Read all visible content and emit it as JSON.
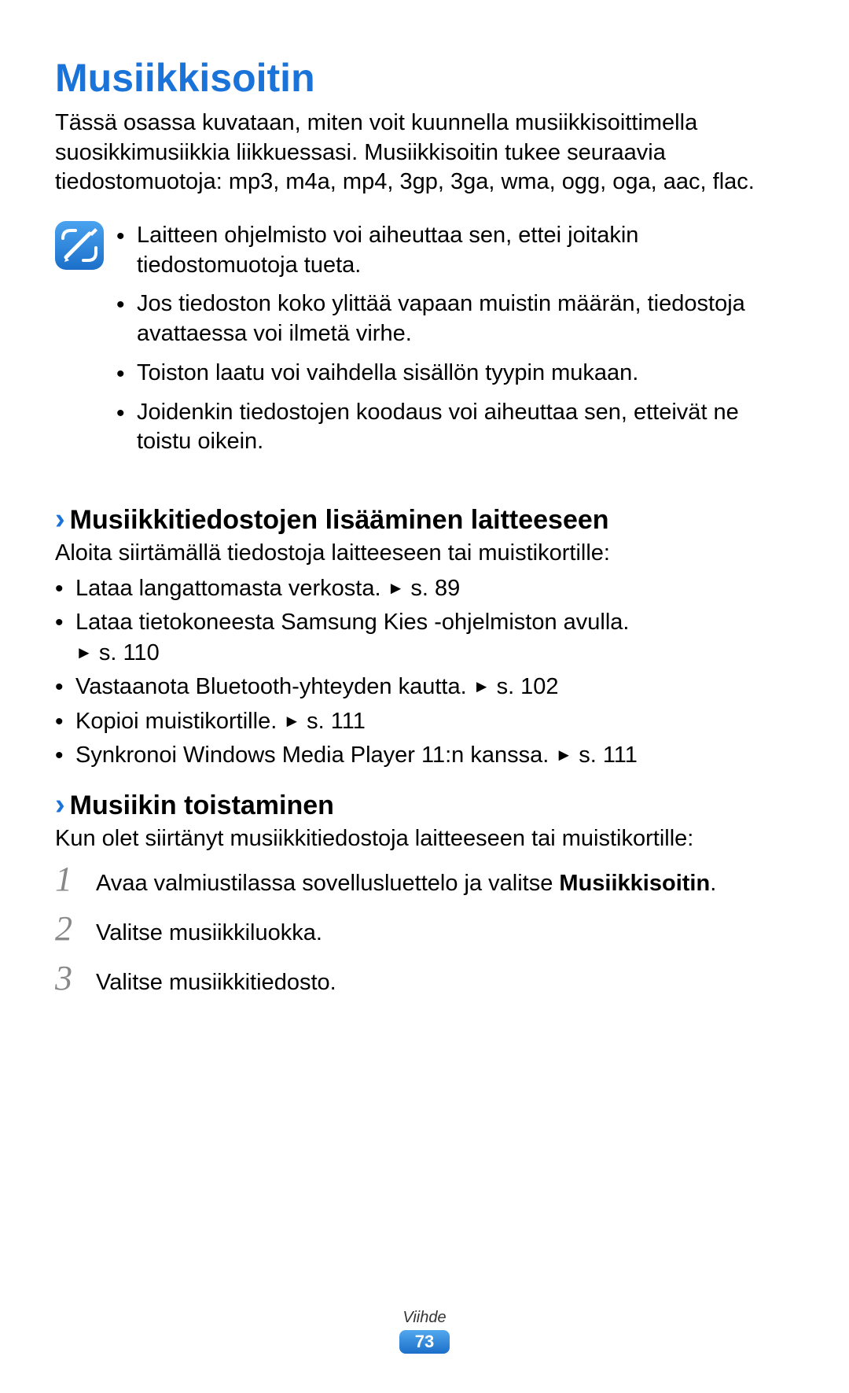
{
  "title": "Musiikkisoitin",
  "intro": "Tässä osassa kuvataan, miten voit kuunnella musiikkisoittimella suosikkimusiikkia liikkuessasi. Musiikkisoitin tukee seuraavia tiedostomuotoja: mp3, m4a, mp4, 3gp, 3ga, wma, ogg, oga, aac, flac.",
  "notes": [
    "Laitteen ohjelmisto voi aiheuttaa sen, ettei joitakin tiedostomuotoja tueta.",
    "Jos tiedoston koko ylittää vapaan muistin määrän, tiedostoja avattaessa voi ilmetä virhe.",
    "Toiston laatu voi vaihdella sisällön tyypin mukaan.",
    "Joidenkin tiedostojen koodaus voi aiheuttaa sen, etteivät ne toistu oikein."
  ],
  "section1": {
    "heading": "Musiikkitiedostojen lisääminen laitteeseen",
    "intro": "Aloita siirtämällä tiedostoja laitteeseen tai muistikortille:",
    "items": [
      {
        "text": "Lataa langattomasta verkosta.",
        "ref": "s. 89"
      },
      {
        "text": "Lataa tietokoneesta Samsung Kies -ohjelmiston avulla.",
        "ref": "s. 110"
      },
      {
        "text": "Vastaanota Bluetooth-yhteyden kautta.",
        "ref": "s. 102"
      },
      {
        "text": "Kopioi muistikortille.",
        "ref": "s. 111"
      },
      {
        "text": "Synkronoi Windows Media Player 11:n kanssa.",
        "ref": "s. 111"
      }
    ]
  },
  "section2": {
    "heading": "Musiikin toistaminen",
    "intro": "Kun olet siirtänyt musiikkitiedostoja laitteeseen tai muistikortille:",
    "steps": [
      {
        "num": "1",
        "pre": "Avaa valmiustilassa sovellusluettelo ja valitse ",
        "bold": "Musiikkisoitin",
        "post": "."
      },
      {
        "num": "2",
        "pre": "Valitse musiikkiluokka.",
        "bold": "",
        "post": ""
      },
      {
        "num": "3",
        "pre": "Valitse musiikkitiedosto.",
        "bold": "",
        "post": ""
      }
    ]
  },
  "footer": {
    "section_label": "Viihde",
    "page_number": "73"
  }
}
